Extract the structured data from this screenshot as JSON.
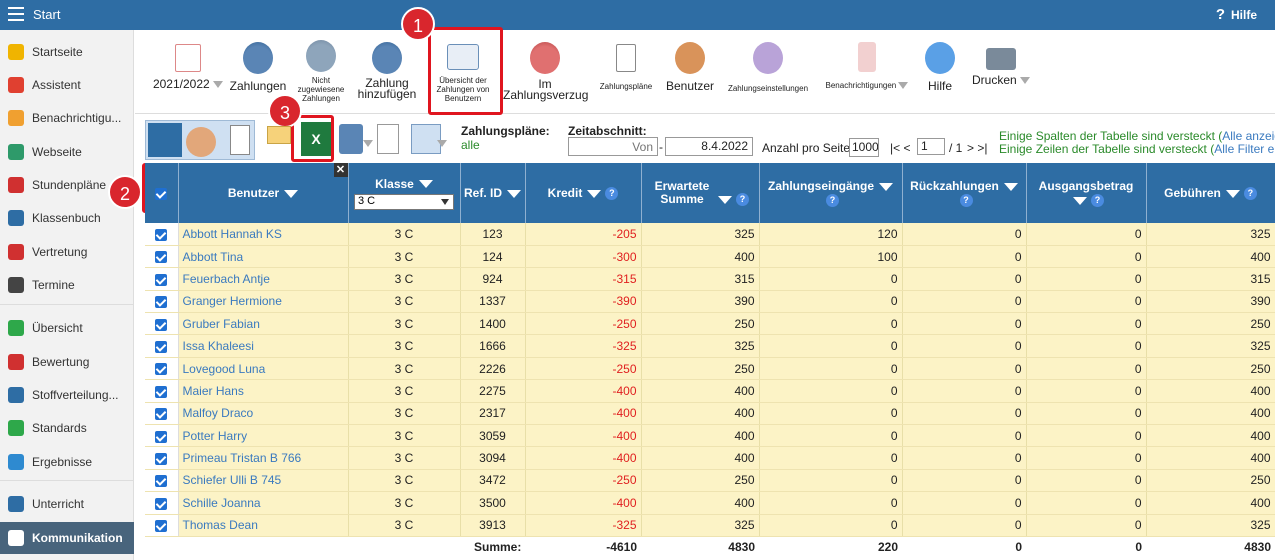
{
  "topbar": {
    "title": "Start",
    "help": "Hilfe"
  },
  "sidebar": {
    "items": [
      {
        "label": "Startseite",
        "color": "#f0b400"
      },
      {
        "label": "Assistent",
        "color": "#e04030"
      },
      {
        "label": "Benachrichtigu...",
        "color": "#f0a030"
      },
      {
        "label": "Webseite",
        "color": "#2e9a6a"
      },
      {
        "label": "Stundenpläne ...",
        "color": "#d03030"
      },
      {
        "label": "Klassenbuch",
        "color": "#2e6da4"
      },
      {
        "label": "Vertretung",
        "color": "#d03030"
      },
      {
        "label": "Termine",
        "color": "#444"
      },
      {
        "label": "Übersicht",
        "color": "#2ea84a"
      },
      {
        "label": "Bewertung",
        "color": "#d03030"
      },
      {
        "label": "Stoffverteilung...",
        "color": "#2e6da4"
      },
      {
        "label": "Standards",
        "color": "#2ea84a"
      },
      {
        "label": "Ergebnisse",
        "color": "#2e8ad0"
      },
      {
        "label": "Unterricht",
        "color": "#2e6da4"
      },
      {
        "label": "Kommunikation",
        "color": "#fff"
      }
    ]
  },
  "toolbar": {
    "year": "2021/2022",
    "zahlungen": "Zahlungen",
    "nicht": "Nicht zugewiesene Zahlungen",
    "zahlung_hinzu": "Zahlung hinzufügen",
    "uebersicht": "Übersicht der Zahlungen von Benutzern",
    "verzug": "Im Zahlungsverzug",
    "plaene": "Zahlungspläne",
    "benutzer": "Benutzer",
    "einstellungen": "Zahlungseinstellungen",
    "benachrichtigungen": "Benachrichtigungen",
    "hilfe": "Hilfe",
    "drucken": "Drucken"
  },
  "badges": {
    "b1": "1",
    "b2": "2",
    "b3": "3"
  },
  "filters": {
    "plaene_label": "Zahlungspläne:",
    "plaene_value": "alle",
    "zeit_label": "Zeitabschnitt:",
    "von_placeholder": "Von",
    "dash": "-",
    "bis_value": "8.4.2022",
    "anzahl_label": "Anzahl pro Seite:",
    "anzahl_value": "1000",
    "pager_prev": "|< <",
    "page": "1",
    "page_total": "/ 1",
    "pager_next": "> >|",
    "hidden_cols": "Einige Spalten der Tabelle sind versteckt (",
    "show_all": "Alle anzeigen",
    "hidden_rows": "Einige Zeilen der Tabelle sind versteckt (",
    "remove_filters": "Alle Filter entfe"
  },
  "table": {
    "headers": {
      "benutzer": "Benutzer",
      "klasse": "Klasse",
      "klasse_filter": "3 C",
      "refid": "Ref. ID",
      "kredit": "Kredit",
      "erwartete": "Erwartete Summe",
      "eingaenge": "Zahlungseingänge",
      "rueck": "Rückzahlungen",
      "ausgang": "Ausgangsbetrag",
      "gebuehren": "Gebühren"
    },
    "rows": [
      {
        "name": "Abbott Hannah KS",
        "klasse": "3 C",
        "ref": "123",
        "kredit": "-205",
        "erw": "325",
        "ein": "120",
        "rueck": "0",
        "aus": "0",
        "geb": "325"
      },
      {
        "name": "Abbott Tina",
        "klasse": "3 C",
        "ref": "124",
        "kredit": "-300",
        "erw": "400",
        "ein": "100",
        "rueck": "0",
        "aus": "0",
        "geb": "400"
      },
      {
        "name": "Feuerbach Antje",
        "klasse": "3 C",
        "ref": "924",
        "kredit": "-315",
        "erw": "315",
        "ein": "0",
        "rueck": "0",
        "aus": "0",
        "geb": "315"
      },
      {
        "name": "Granger Hermione",
        "klasse": "3 C",
        "ref": "1337",
        "kredit": "-390",
        "erw": "390",
        "ein": "0",
        "rueck": "0",
        "aus": "0",
        "geb": "390"
      },
      {
        "name": "Gruber Fabian",
        "klasse": "3 C",
        "ref": "1400",
        "kredit": "-250",
        "erw": "250",
        "ein": "0",
        "rueck": "0",
        "aus": "0",
        "geb": "250"
      },
      {
        "name": "Issa Khaleesi",
        "klasse": "3 C",
        "ref": "1666",
        "kredit": "-325",
        "erw": "325",
        "ein": "0",
        "rueck": "0",
        "aus": "0",
        "geb": "325"
      },
      {
        "name": "Lovegood Luna",
        "klasse": "3 C",
        "ref": "2226",
        "kredit": "-250",
        "erw": "250",
        "ein": "0",
        "rueck": "0",
        "aus": "0",
        "geb": "250"
      },
      {
        "name": "Maier Hans",
        "klasse": "3 C",
        "ref": "2275",
        "kredit": "-400",
        "erw": "400",
        "ein": "0",
        "rueck": "0",
        "aus": "0",
        "geb": "400"
      },
      {
        "name": "Malfoy Draco",
        "klasse": "3 C",
        "ref": "2317",
        "kredit": "-400",
        "erw": "400",
        "ein": "0",
        "rueck": "0",
        "aus": "0",
        "geb": "400"
      },
      {
        "name": "Potter Harry",
        "klasse": "3 C",
        "ref": "3059",
        "kredit": "-400",
        "erw": "400",
        "ein": "0",
        "rueck": "0",
        "aus": "0",
        "geb": "400"
      },
      {
        "name": "Primeau Tristan B 766",
        "klasse": "3 C",
        "ref": "3094",
        "kredit": "-400",
        "erw": "400",
        "ein": "0",
        "rueck": "0",
        "aus": "0",
        "geb": "400"
      },
      {
        "name": "Schiefer Ulli B 745",
        "klasse": "3 C",
        "ref": "3472",
        "kredit": "-250",
        "erw": "250",
        "ein": "0",
        "rueck": "0",
        "aus": "0",
        "geb": "250"
      },
      {
        "name": "Schille Joanna",
        "klasse": "3 C",
        "ref": "3500",
        "kredit": "-400",
        "erw": "400",
        "ein": "0",
        "rueck": "0",
        "aus": "0",
        "geb": "400"
      },
      {
        "name": "Thomas Dean",
        "klasse": "3 C",
        "ref": "3913",
        "kredit": "-325",
        "erw": "325",
        "ein": "0",
        "rueck": "0",
        "aus": "0",
        "geb": "325"
      }
    ],
    "footer": {
      "label": "Summe:",
      "kredit": "-4610",
      "erw": "4830",
      "ein": "220",
      "rueck": "0",
      "aus": "0",
      "geb": "4830"
    }
  }
}
